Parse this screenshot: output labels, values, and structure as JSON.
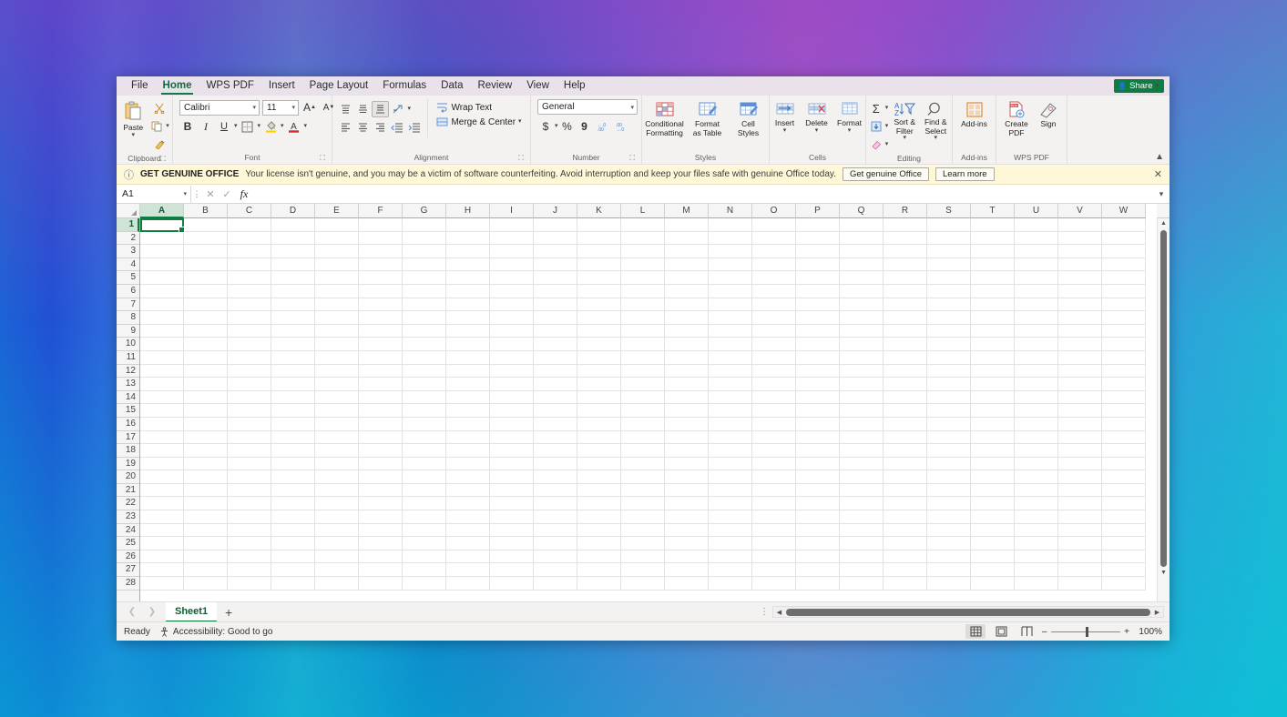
{
  "app": {
    "share_label": "Share",
    "collapse_ribbon_icon": "chevron-up-icon"
  },
  "tabs": [
    {
      "label": "File",
      "active": false
    },
    {
      "label": "Home",
      "active": true
    },
    {
      "label": "WPS PDF",
      "active": false
    },
    {
      "label": "Insert",
      "active": false
    },
    {
      "label": "Page Layout",
      "active": false
    },
    {
      "label": "Formulas",
      "active": false
    },
    {
      "label": "Data",
      "active": false
    },
    {
      "label": "Review",
      "active": false
    },
    {
      "label": "View",
      "active": false
    },
    {
      "label": "Help",
      "active": false
    }
  ],
  "ribbon": {
    "clipboard": {
      "label": "Clipboard",
      "paste_label": "Paste",
      "cut_icon": "scissors-icon",
      "copy_icon": "copy-icon",
      "format_painter_icon": "format-painter-icon",
      "dialog_launcher_icon": "dialog-launcher-icon"
    },
    "font": {
      "label": "Font",
      "font_family_value": "Calibri",
      "font_size_value": "11",
      "grow_font_label": "A",
      "shrink_font_label": "A",
      "bold_label": "B",
      "italic_label": "I",
      "underline_label": "U",
      "borders_icon": "borders-icon",
      "fill_color_icon": "fill-color-icon",
      "font_color_icon": "font-color-icon",
      "dialog_launcher_icon": "dialog-launcher-icon"
    },
    "alignment": {
      "label": "Alignment",
      "align_top_icon": "align-top-icon",
      "align_middle_icon": "align-middle-icon",
      "align_bottom_icon": "align-bottom-icon",
      "orientation_icon": "orientation-icon",
      "align_left_icon": "align-left-icon",
      "align_center_icon": "align-center-icon",
      "align_right_icon": "align-right-icon",
      "decrease_indent_icon": "decrease-indent-icon",
      "increase_indent_icon": "increase-indent-icon",
      "wrap_text_label": "Wrap Text",
      "merge_center_label": "Merge & Center",
      "dialog_launcher_icon": "dialog-launcher-icon"
    },
    "number": {
      "label": "Number",
      "format_value": "General",
      "accounting_label": "$",
      "percent_label": "%",
      "comma_label": "9",
      "increase_decimal_icon": "increase-decimal-icon",
      "decrease_decimal_icon": "decrease-decimal-icon",
      "dialog_launcher_icon": "dialog-launcher-icon"
    },
    "styles": {
      "label": "Styles",
      "conditional_formatting_label": "Conditional Formatting",
      "format_as_table_label": "Format as Table",
      "cell_styles_label": "Cell Styles"
    },
    "cells": {
      "label": "Cells",
      "insert_label": "Insert",
      "delete_label": "Delete",
      "format_label": "Format"
    },
    "editing": {
      "label": "Editing",
      "autosum_label": "Σ",
      "fill_icon": "fill-down-icon",
      "clear_icon": "eraser-icon",
      "sort_filter_label": "Sort & Filter",
      "find_select_label": "Find & Select"
    },
    "addins": {
      "label": "Add-ins",
      "addins_label": "Add-ins"
    },
    "wpspdf": {
      "label": "WPS PDF",
      "create_pdf_label": "Create PDF",
      "sign_label": "Sign"
    }
  },
  "notification": {
    "info_icon": "info-circle-icon",
    "headline": "GET GENUINE OFFICE",
    "message": "Your license isn't genuine, and you may be a victim of software counterfeiting. Avoid interruption and keep your files safe with genuine Office today.",
    "primary_button": "Get genuine Office",
    "secondary_button": "Learn more",
    "close_icon": "close-icon"
  },
  "formula_bar": {
    "name_box_value": "A1",
    "name_box_caret_icon": "chevron-down-icon",
    "cancel_icon": "cancel-x-icon",
    "enter_icon": "enter-check-icon",
    "function_icon": "fx-icon",
    "formula_value": "",
    "expand_icon": "chevron-down-icon"
  },
  "grid": {
    "columns": [
      "A",
      "B",
      "C",
      "D",
      "E",
      "F",
      "G",
      "H",
      "I",
      "J",
      "K",
      "L",
      "M",
      "N",
      "O",
      "P",
      "Q",
      "R",
      "S",
      "T",
      "U",
      "V",
      "W"
    ],
    "selected_column": "A",
    "rows": [
      1,
      2,
      3,
      4,
      5,
      6,
      7,
      8,
      9,
      10,
      11,
      12,
      13,
      14,
      15,
      16,
      17,
      18,
      19,
      20,
      21,
      22,
      23,
      24,
      25,
      26,
      27,
      28
    ],
    "selected_row": 1,
    "active_cell": "A1",
    "active_cell_value": "",
    "select_all_icon": "select-all-corner-icon"
  },
  "sheet_bar": {
    "prev_icon": "chevron-left-icon",
    "next_icon": "chevron-right-icon",
    "sheets": [
      {
        "name": "Sheet1",
        "active": true
      }
    ],
    "add_sheet_icon": "plus-icon"
  },
  "status_bar": {
    "state": "Ready",
    "accessibility_icon": "accessibility-icon",
    "accessibility_text": "Accessibility: Good to go",
    "view_normal_icon": "normal-view-icon",
    "view_page_layout_icon": "page-layout-view-icon",
    "view_page_break_icon": "page-break-view-icon",
    "zoom_out_label": "–",
    "zoom_in_label": "+",
    "zoom_value": "100%"
  },
  "colors": {
    "accent_green": "#107c41",
    "ribbon_bg": "#f3f2f1",
    "notify_bg": "#fff8d8",
    "tabbar_bg": "#e9e2ea"
  }
}
